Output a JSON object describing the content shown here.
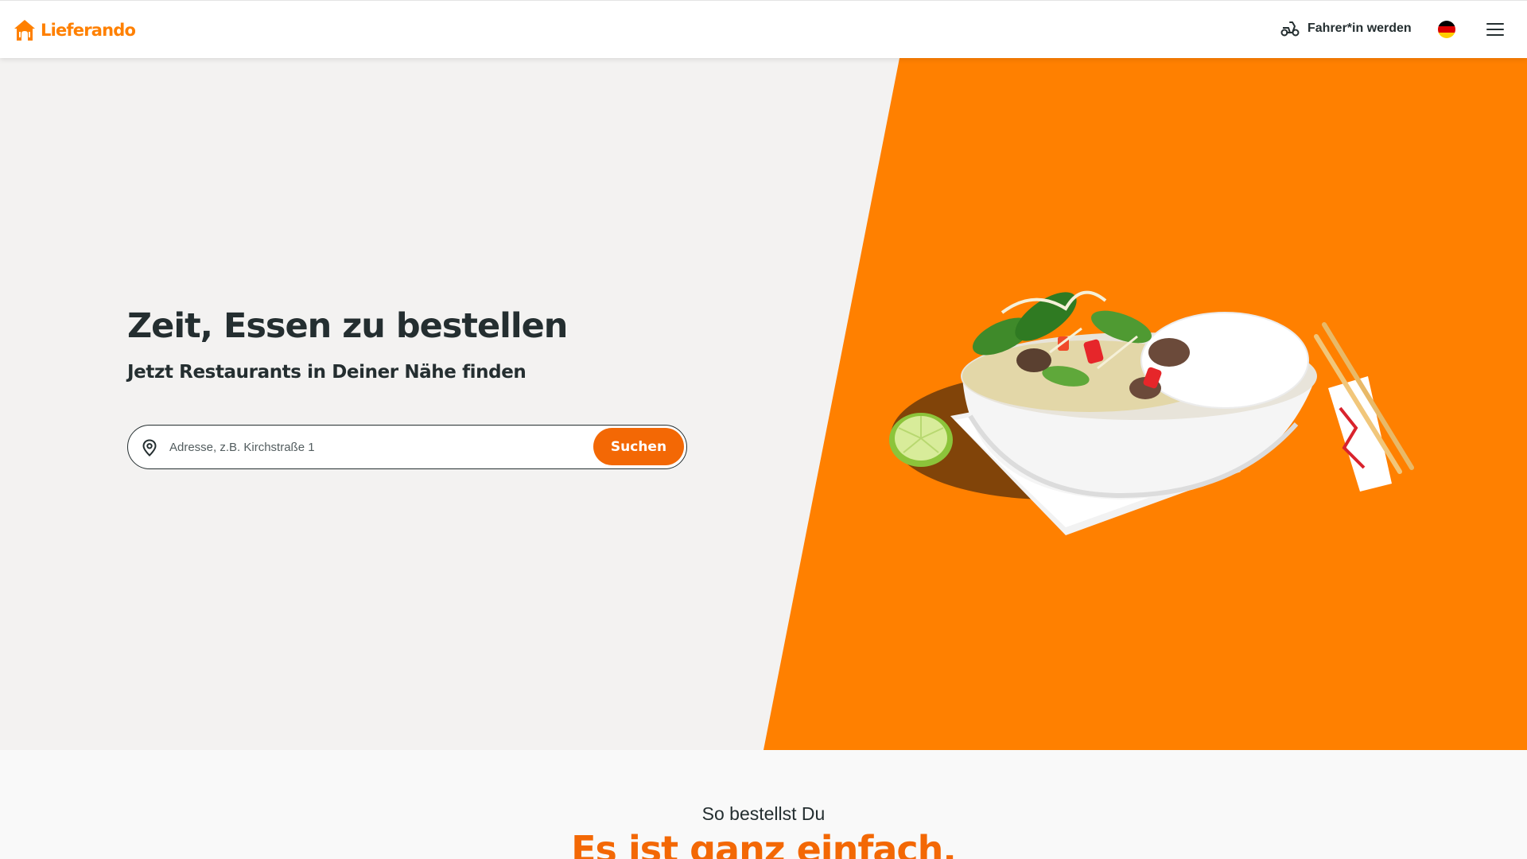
{
  "header": {
    "logo_text": "Lieferando",
    "courier_link": "Fahrer*in werden",
    "language": "Deutsch",
    "menu_icon": "hamburger-menu-icon"
  },
  "hero": {
    "title": "Zeit, Essen zu bestellen",
    "subtitle": "Jetzt Restaurants in Deiner Nähe finden",
    "search": {
      "placeholder": "Adresse, z.B. Kirchstraße 1",
      "value": "",
      "button_label": "Suchen",
      "icon": "location-pin-icon"
    }
  },
  "how_to_order": {
    "kicker": "So bestellst Du",
    "title": "Es ist ganz einfach."
  },
  "colors": {
    "brand_orange": "#ff8000",
    "button_orange": "#f36805",
    "text_dark": "#242e30",
    "hero_background": "#f3f2f1"
  }
}
